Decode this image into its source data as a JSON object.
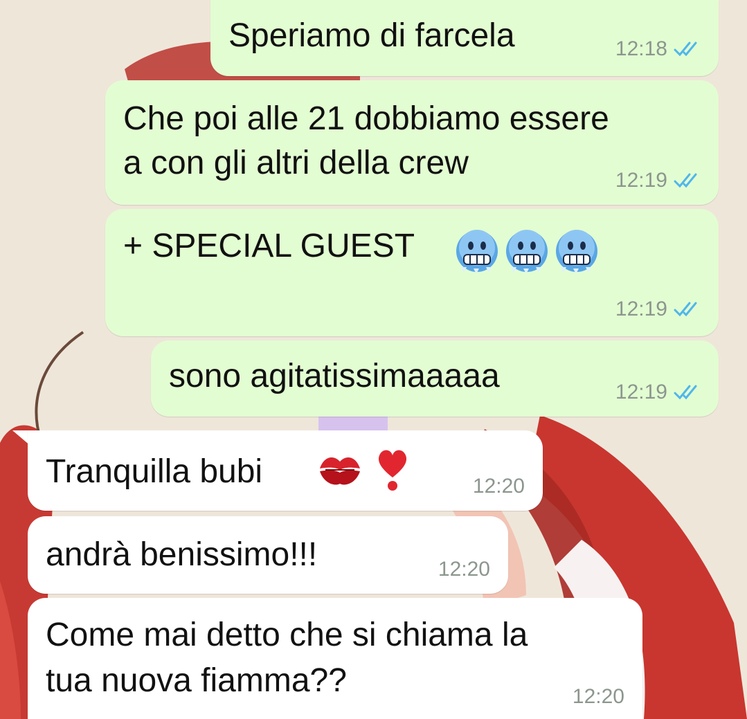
{
  "colors": {
    "outgoing_bubble": "#e3fdd2",
    "incoming_bubble": "#ffffff",
    "read_ticks": "#4fb6ec",
    "time_text": "#8c968e",
    "wallpaper": "#efe6da"
  },
  "messages": [
    {
      "direction": "outgoing",
      "lines": [
        "Speriamo di farcela"
      ],
      "time": "12:18",
      "status": "read-double-check-icon"
    },
    {
      "direction": "outgoing",
      "lines": [
        "Che poi alle 21 dobbiamo essere",
        "a con gli altri della crew"
      ],
      "time": "12:19",
      "status": "read-double-check-icon"
    },
    {
      "direction": "outgoing",
      "lines": [
        "+ SPECIAL GUEST"
      ],
      "emojis": [
        "freezing-face-icon",
        "freezing-face-icon",
        "freezing-face-icon"
      ],
      "time": "12:19",
      "status": "read-double-check-icon"
    },
    {
      "direction": "outgoing",
      "lines": [
        "sono agitatissimaaaaa"
      ],
      "time": "12:19",
      "status": "read-double-check-icon"
    },
    {
      "direction": "incoming",
      "lines": [
        "Tranquilla bubi"
      ],
      "emojis": [
        "kiss-mark-icon",
        "heart-exclamation-icon"
      ],
      "time": "12:20"
    },
    {
      "direction": "incoming",
      "lines": [
        "andrà benissimo!!!"
      ],
      "time": "12:20"
    },
    {
      "direction": "incoming",
      "lines": [
        "Come mai detto che si chiama la",
        "tua nuova fiamma??"
      ],
      "time": "12:20"
    }
  ]
}
